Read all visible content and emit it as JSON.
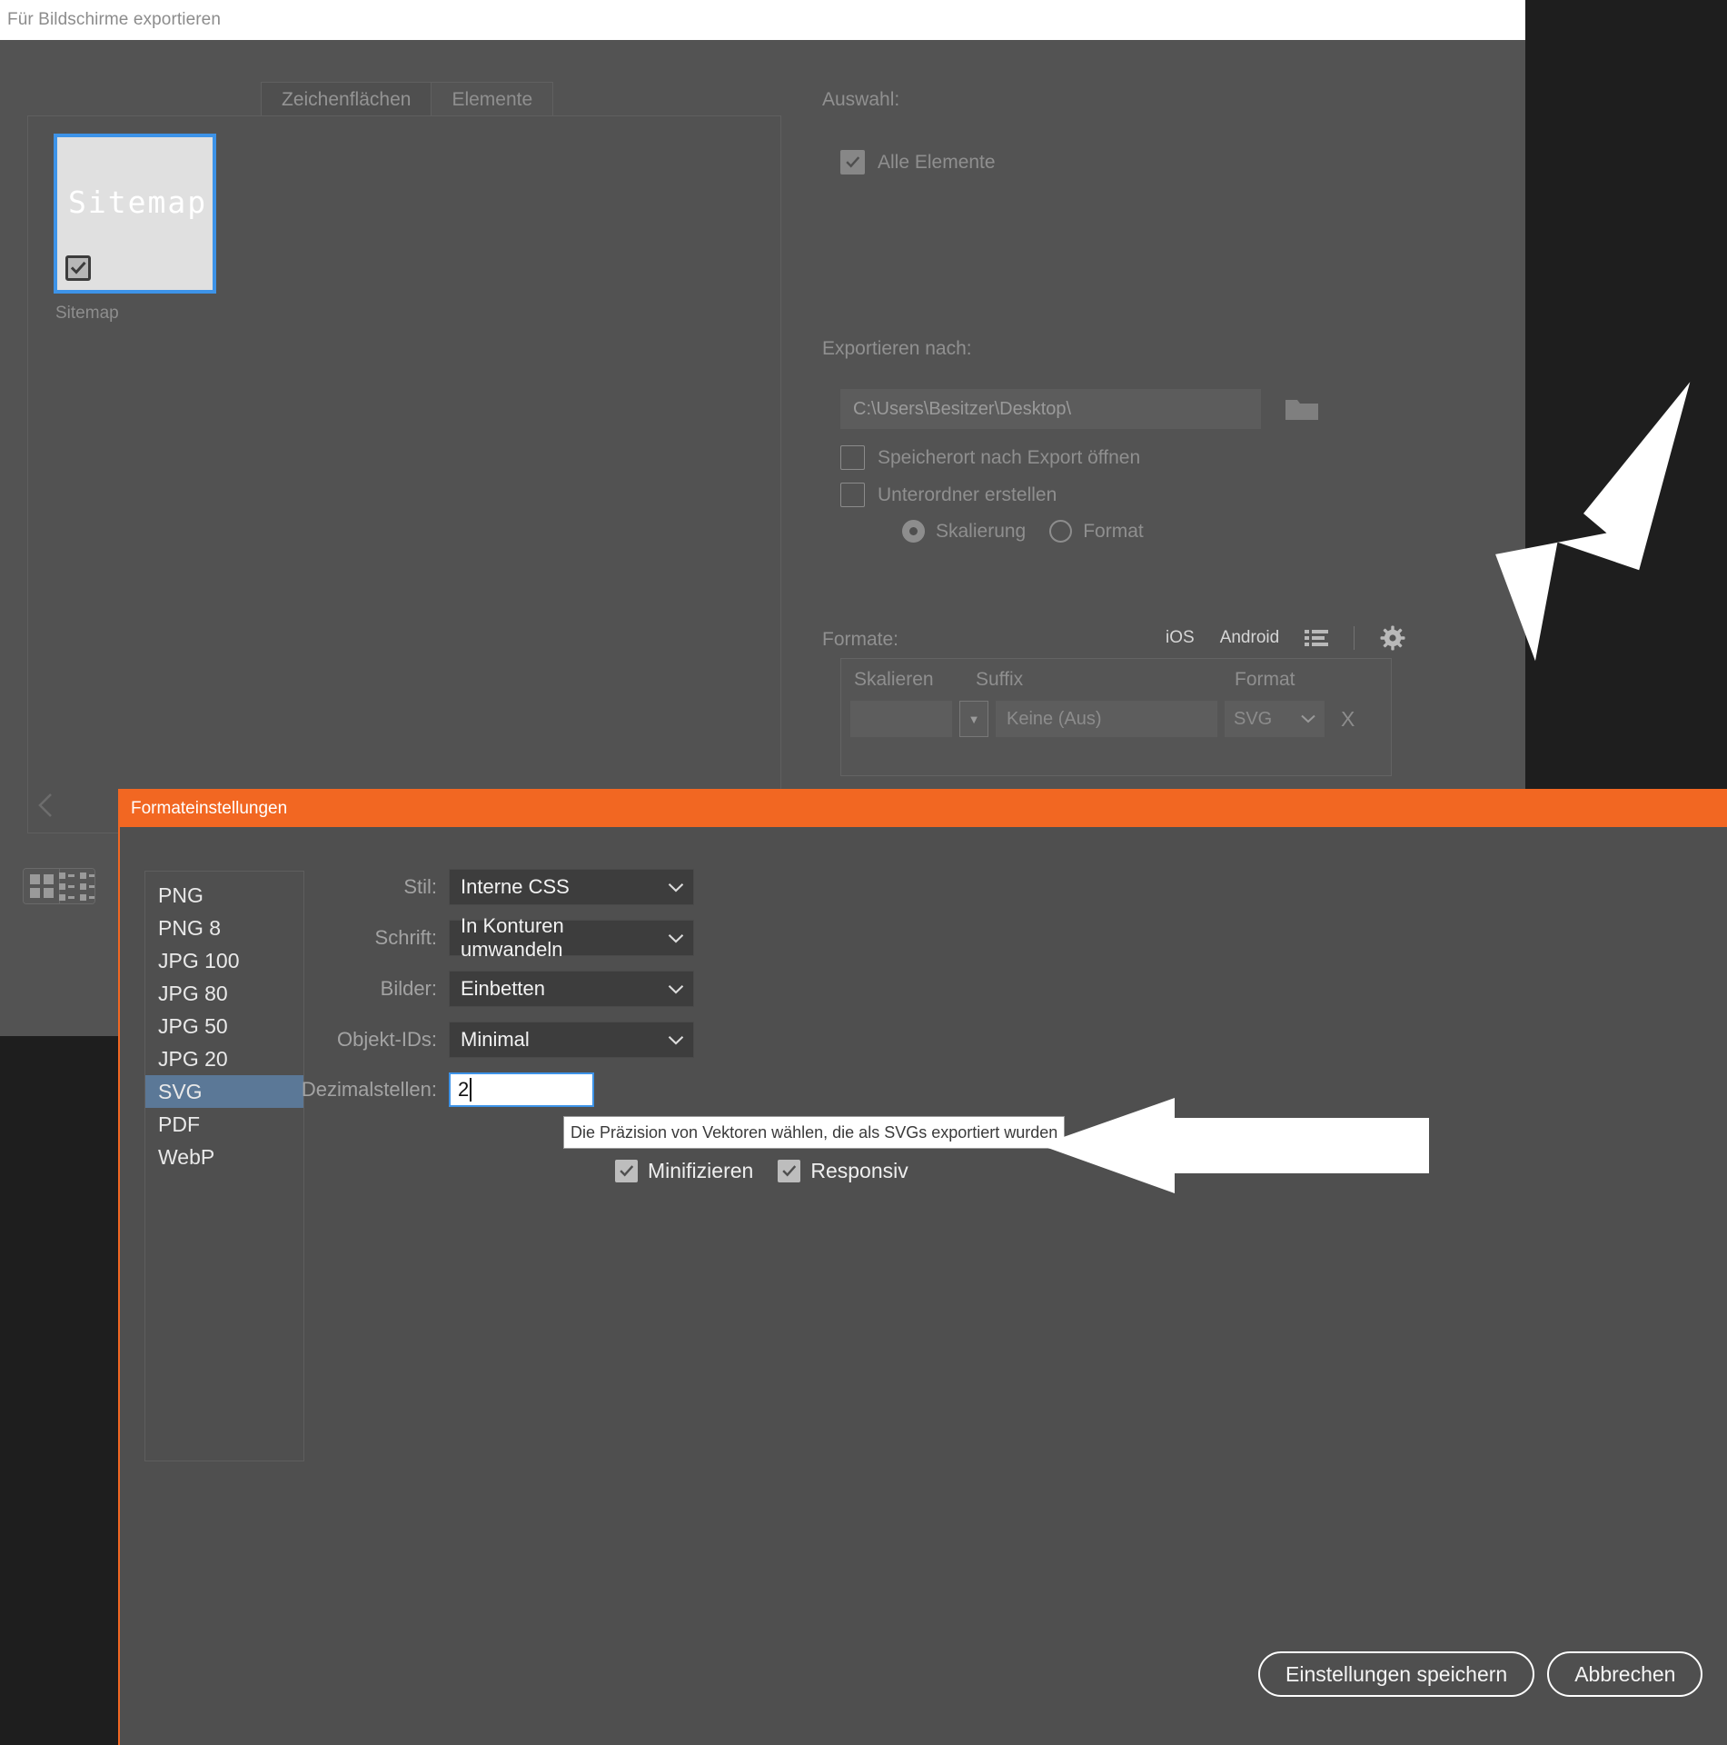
{
  "window": {
    "title": "Für Bildschirme exportieren"
  },
  "tabs": [
    {
      "label": "Zeichenflächen",
      "active": true
    },
    {
      "label": "Elemente",
      "active": false
    }
  ],
  "artboards": {
    "items": [
      {
        "thumb_text": "Sitemap",
        "caption": "Sitemap",
        "checked": true,
        "selected": true
      }
    ],
    "view_modes": [
      {
        "name": "grid-view",
        "active": true
      },
      {
        "name": "detail-view",
        "active": false
      }
    ]
  },
  "options": {
    "selection_label": "Auswahl:",
    "all_elements": {
      "label": "Alle Elemente",
      "checked": true
    },
    "export_to_label": "Exportieren nach:",
    "path_value": "C:\\Users\\Besitzer\\Desktop\\",
    "open_location": {
      "label": "Speicherort nach Export öffnen",
      "checked": false
    },
    "create_subfolder": {
      "label": "Unterordner erstellen",
      "checked": false
    },
    "mode_radios": [
      {
        "label": "Skalierung",
        "selected": true
      },
      {
        "label": "Format",
        "selected": false
      }
    ]
  },
  "formats": {
    "label": "Formate:",
    "platforms": [
      "iOS",
      "Android"
    ],
    "columns": [
      "Skalieren",
      "Suffix",
      "Format"
    ],
    "rows": [
      {
        "scale": "",
        "suffix": "Keine (Aus)",
        "format": "SVG",
        "remove": "X"
      }
    ]
  },
  "format_settings_dialog": {
    "title": "Formateinstellungen",
    "format_list": [
      "PNG",
      "PNG 8",
      "JPG 100",
      "JPG 80",
      "JPG 50",
      "JPG 20",
      "SVG",
      "PDF",
      "WebP"
    ],
    "selected_format": "SVG",
    "fields": [
      {
        "label": "Stil:",
        "value": "Interne CSS",
        "type": "select"
      },
      {
        "label": "Schrift:",
        "value": "In Konturen umwandeln",
        "type": "select"
      },
      {
        "label": "Bilder:",
        "value": "Einbetten",
        "type": "select"
      },
      {
        "label": "Objekt-IDs:",
        "value": "Minimal",
        "type": "select"
      },
      {
        "label": "Dezimalstellen:",
        "value": "2",
        "type": "input"
      }
    ],
    "tooltip": "Die Präzision von Vektoren wählen, die als SVGs exportiert wurden",
    "checkboxes": [
      {
        "label": "Minifizieren",
        "checked": true
      },
      {
        "label": "Responsiv",
        "checked": true
      }
    ],
    "buttons": [
      {
        "label": "Einstellungen speichern"
      },
      {
        "label": "Abbrechen"
      }
    ]
  },
  "colors": {
    "accent_orange": "#f26722",
    "selection_blue": "#3d93e8",
    "list_selected_blue": "#5b7897",
    "panel_gray": "#4f4f4f",
    "backdrop": "#1e1e1e"
  }
}
